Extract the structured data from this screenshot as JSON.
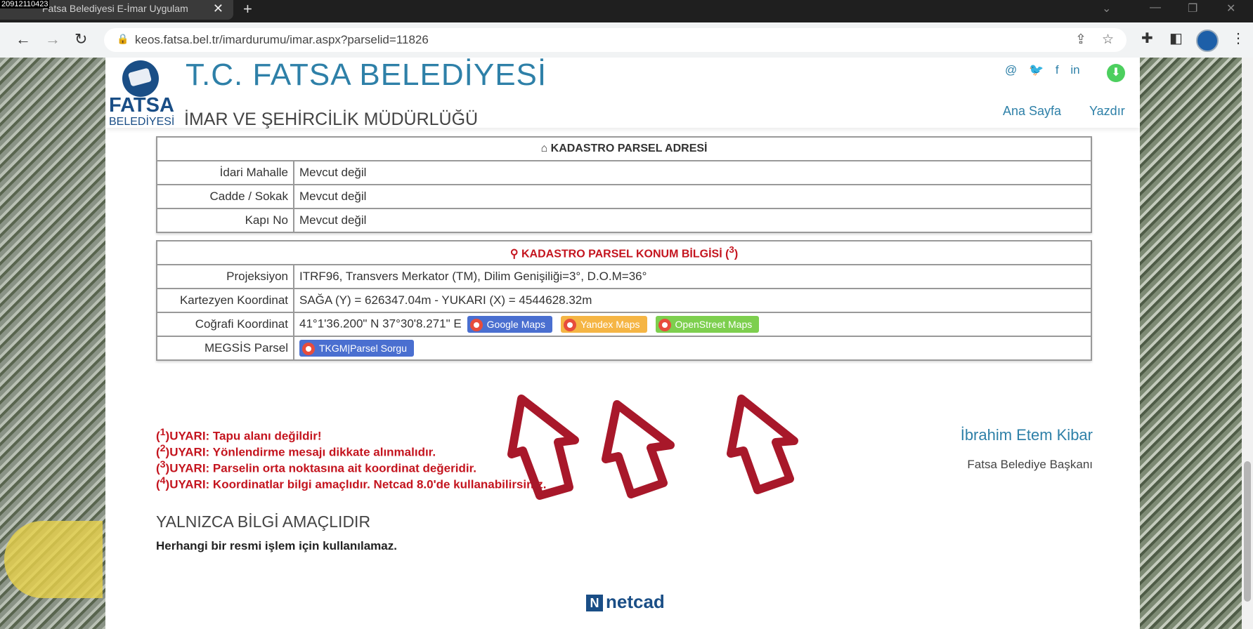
{
  "stamp": "20912110423",
  "browser": {
    "tab_title": "Fatsa Belediyesi E-İmar Uygulam",
    "url": "keos.fatsa.bel.tr/imardurumu/imar.aspx?parselid=11826"
  },
  "header": {
    "logo_text": "FATSA",
    "logo_sub": "BELEDİYESİ",
    "title": "T.C. FATSA BELEDİYESİ",
    "subtitle": "İMAR VE ŞEHİRCİLİK MÜDÜRLÜĞÜ",
    "social": [
      "@",
      "🐦",
      "f",
      "in"
    ],
    "nav": [
      "Ana Sayfa",
      "Yazdır"
    ]
  },
  "address": {
    "heading": "KADASTRO PARSEL ADRESİ",
    "rows": [
      {
        "label": "İdari Mahalle",
        "value": "Mevcut değil"
      },
      {
        "label": "Cadde / Sokak",
        "value": "Mevcut değil"
      },
      {
        "label": "Kapı No",
        "value": "Mevcut değil"
      }
    ]
  },
  "location": {
    "heading": "KADASTRO PARSEL KONUM BİLGİSİ",
    "heading_note": "3",
    "projection_label": "Projeksiyon",
    "projection_value": "ITRF96, Transvers Merkator (TM), Dilim Genişiliği=3°, D.O.M=36°",
    "cartesian_label": "Kartezyen Koordinat",
    "cartesian_value": "SAĞA (Y) = 626347.04m - YUKARI (X) = 4544628.32m",
    "geo_label": "Coğrafi Koordinat",
    "geo_value": "41°1'36.200\" N 37°30'8.271\" E",
    "map_buttons": [
      {
        "label": "Google Maps",
        "color": "#4a6fd0"
      },
      {
        "label": "Yandex Maps",
        "color": "#f5b544"
      },
      {
        "label": "OpenStreet Maps",
        "color": "#7dcf4e"
      }
    ],
    "megsis_label": "MEGSİS Parsel",
    "megsis_button": "TKGM|Parsel Sorgu"
  },
  "warnings": [
    {
      "num": "1",
      "text": "UYARI: Tapu alanı değildir!"
    },
    {
      "num": "2",
      "text": "UYARI: Yönlendirme mesajı dikkate alınmalıdır."
    },
    {
      "num": "3",
      "text": "UYARI: Parselin orta noktasına ait koordinat değeridir."
    },
    {
      "num": "4",
      "text": "UYARI: Koordinatlar bilgi amaçlıdır. Netcad 8.0'de kullanabilirsiniz."
    }
  ],
  "mayor": {
    "name": "İbrahim Etem Kibar",
    "title": "Fatsa Belediye Başkanı"
  },
  "footer": {
    "notice": "YALNIZCA BİLGİ AMAÇLIDIR",
    "notice_sub": "Herhangi bir resmi işlem için kullanılamaz.",
    "brand": "netcad"
  },
  "colors": {
    "accent": "#2e80a8",
    "warning": "#c4141e",
    "annotation_arrow": "#a8182a"
  }
}
